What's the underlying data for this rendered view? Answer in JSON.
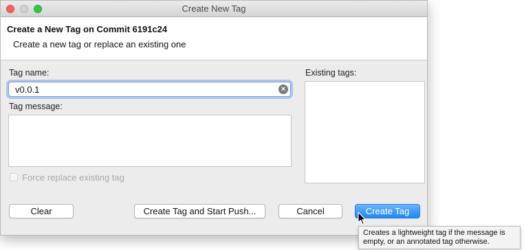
{
  "window": {
    "title": "Create New Tag"
  },
  "banner": {
    "title": "Create a New Tag on Commit 6191c24",
    "subtitle": "Create a new tag or replace an existing one"
  },
  "form": {
    "tag_name_label": "Tag name:",
    "tag_name_value": "v0.0.1",
    "tag_message_label": "Tag message:",
    "tag_message_value": "",
    "existing_tags_label": "Existing tags:",
    "existing_tags": [],
    "force_replace_label": "Force replace existing tag",
    "force_replace_checked": false,
    "force_replace_enabled": false
  },
  "buttons": {
    "clear": "Clear",
    "create_and_push": "Create Tag and Start Push...",
    "cancel": "Cancel",
    "create": "Create Tag"
  },
  "tooltip": {
    "text": "Creates a lightweight tag if the message is empty, or an annotated tag otherwise."
  },
  "icons": {
    "clear_field": "clear-circle-icon",
    "cursor": "arrow-cursor-icon"
  },
  "colors": {
    "primary_button": "#1d86f4",
    "focus_ring": "#5d9ae4",
    "close_button": "#fc605c",
    "maximize_button": "#34c84a"
  }
}
